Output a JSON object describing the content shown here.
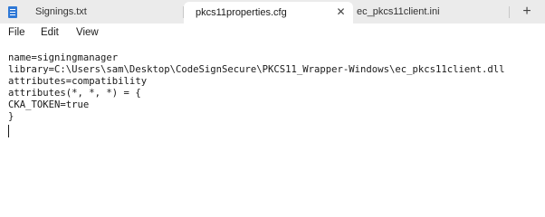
{
  "tabs": [
    {
      "label": "Signings.txt",
      "active": false
    },
    {
      "label": "pkcs11properties.cfg",
      "active": true
    },
    {
      "label": "ec_pkcs11client.ini",
      "active": false
    }
  ],
  "tab_close_glyph": "✕",
  "new_tab_glyph": "+",
  "menu": {
    "file": "File",
    "edit": "Edit",
    "view": "View"
  },
  "editor": {
    "lines": [
      "name=signingmanager",
      "library=C:\\Users\\sam\\Desktop\\CodeSignSecure\\PKCS11_Wrapper-Windows\\ec_pkcs11client.dll",
      "attributes=compatibility",
      "attributes(*, *, *) = {",
      "CKA_TOKEN=true",
      "}"
    ]
  },
  "icons": {
    "file_icon": "notepad-file-icon",
    "close_icon": "close-icon",
    "new_tab_icon": "plus-icon"
  },
  "colors": {
    "tabbar_bg": "#ebebeb",
    "active_tab_bg": "#ffffff",
    "file_icon": "#2e78d6"
  }
}
